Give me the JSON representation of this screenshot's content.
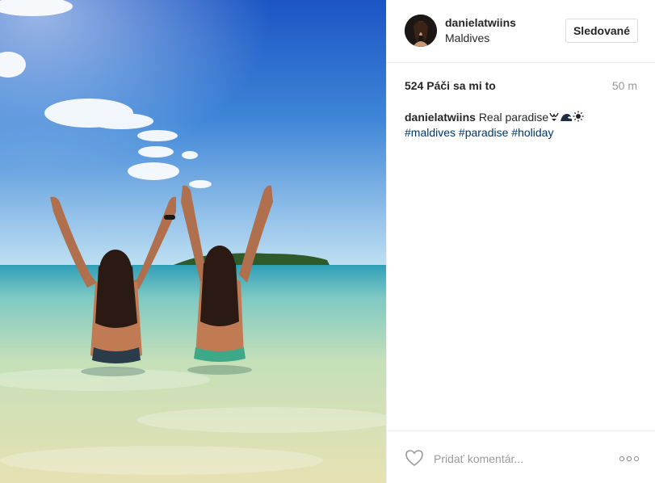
{
  "header": {
    "username": "danielatwiins",
    "location": "Maldives",
    "follow_label": "Sledované"
  },
  "stats": {
    "likes": "524 Páči sa mi to",
    "time_ago": "50 m"
  },
  "caption": {
    "username": "danielatwiins",
    "text": "Real paradise",
    "emojis": [
      "bikini-icon",
      "wave-icon",
      "sun-icon"
    ],
    "hashtags": [
      "#maldives",
      "#paradise",
      "#holiday"
    ]
  },
  "footer": {
    "comment_placeholder": "Pridať komentár...",
    "more_icon": "more-options-icon",
    "like_icon": "heart-icon"
  },
  "colors": {
    "hashtag": "#003569",
    "border": "#efefef",
    "muted": "#999999"
  }
}
